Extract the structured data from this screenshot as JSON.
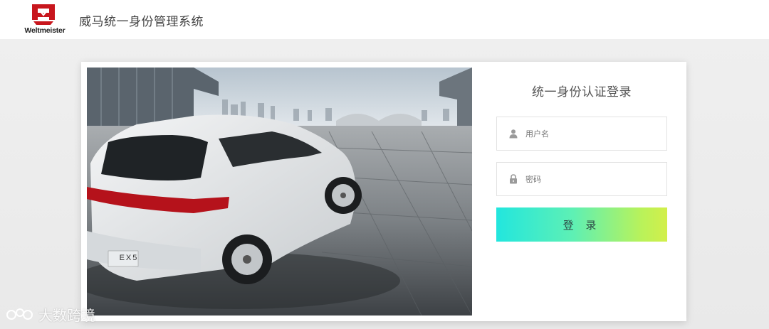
{
  "header": {
    "brand_name": "Weltmeister",
    "system_title": "威马统一身份管理系统"
  },
  "login": {
    "title": "统一身份认证登录",
    "username": {
      "placeholder": "用户名",
      "value": ""
    },
    "password": {
      "placeholder": "密码",
      "value": ""
    },
    "submit_label": "登 录"
  },
  "hero_image": {
    "plate_text": "EX5"
  },
  "watermark": {
    "text": "大数跨境"
  },
  "colors": {
    "brand_red": "#c8161d",
    "button_gradient_start": "#22e6de",
    "button_gradient_end": "#d2ef4a"
  },
  "icons": {
    "username": "user-icon",
    "password": "lock-icon"
  }
}
